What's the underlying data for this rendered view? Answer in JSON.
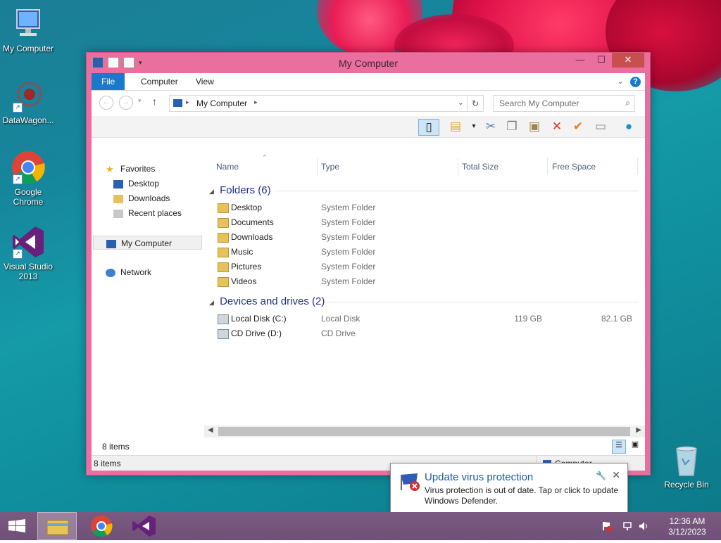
{
  "desktop": {
    "icons": [
      {
        "label": "My Computer"
      },
      {
        "label": "DataWagon..."
      },
      {
        "label": "Google Chrome"
      },
      {
        "label": "Visual Studio 2013"
      },
      {
        "label": "Recycle Bin"
      }
    ]
  },
  "window": {
    "title": "My Computer",
    "ribbon_tabs": [
      "File",
      "Computer",
      "View"
    ],
    "help": "?",
    "address": "My Computer",
    "search_placeholder": "Search My Computer",
    "columns": [
      "Name",
      "Type",
      "Total Size",
      "Free Space"
    ],
    "nav": {
      "favorites": "Favorites",
      "favorites_items": [
        "Desktop",
        "Downloads",
        "Recent places"
      ],
      "my_computer": "My Computer",
      "network": "Network"
    },
    "groups": [
      {
        "title": "Folders (6)",
        "items": [
          {
            "name": "Desktop",
            "type": "System Folder"
          },
          {
            "name": "Documents",
            "type": "System Folder"
          },
          {
            "name": "Downloads",
            "type": "System Folder"
          },
          {
            "name": "Music",
            "type": "System Folder"
          },
          {
            "name": "Pictures",
            "type": "System Folder"
          },
          {
            "name": "Videos",
            "type": "System Folder"
          }
        ]
      },
      {
        "title": "Devices and drives (2)",
        "items": [
          {
            "name": "Local Disk (C:)",
            "type": "Local Disk",
            "total": "119 GB",
            "free": "82.1 GB"
          },
          {
            "name": "CD Drive (D:)",
            "type": "CD Drive",
            "total": "",
            "free": ""
          }
        ]
      }
    ],
    "status_items": "8 items",
    "status_items2": "8 items",
    "status_location": "Computer"
  },
  "notification": {
    "title": "Update virus protection",
    "message": "Virus protection is out of date. Tap or click to update Windows Defender."
  },
  "taskbar": {
    "time": "12:36 AM",
    "date": "3/12/2023"
  },
  "colors": {
    "window_frame": "#ea6f9e",
    "accent": "#1979ca",
    "taskbar": "#6f5078"
  }
}
